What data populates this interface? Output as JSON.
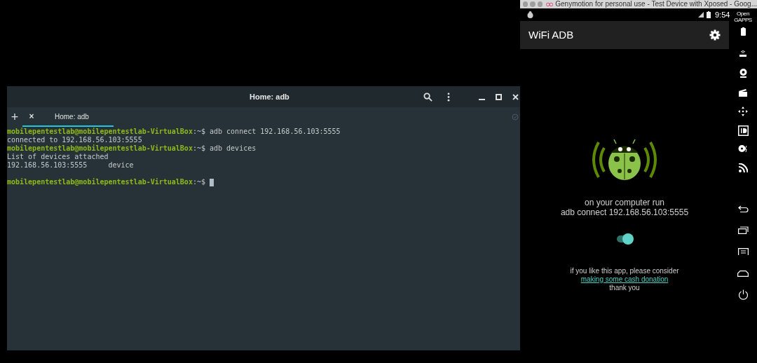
{
  "terminal": {
    "title": "Home: adb",
    "new_tab": "+",
    "tabs": [
      {
        "close": "×",
        "label": "Home: adb",
        "selected": true
      }
    ],
    "lines": [
      {
        "kind": "prompt",
        "user": "mobilepentestlab@mobilepentestlab-VirtualBox",
        "path": ":~$",
        "command": "adb connect 192.168.56.103:5555"
      },
      {
        "kind": "output",
        "text": "connected to 192.168.56.103:5555"
      },
      {
        "kind": "prompt",
        "user": "mobilepentestlab@mobilepentestlab-VirtualBox",
        "path": ":~$",
        "command": "adb devices"
      },
      {
        "kind": "output",
        "text": "List of devices attached"
      },
      {
        "kind": "output",
        "text": "192.168.56.103:5555     device"
      },
      {
        "kind": "blank"
      },
      {
        "kind": "prompt",
        "user": "mobilepentestlab@mobilepentestlab-VirtualBox",
        "path": ":~$",
        "cursor": true
      }
    ]
  },
  "emulator": {
    "window_title": "Genymotion for personal use - Test Device with Xposed - Goog...",
    "status_time": "9:54",
    "app_title": "WiFi ADB",
    "instructions": [
      "on your computer run",
      "adb connect 192.168.56.103:5555"
    ],
    "toggle": {
      "on": true
    },
    "donation": {
      "text": "if you like this app, please consider",
      "link": "making some cash donation",
      "thanks": "thank you"
    },
    "sidebar_label": "Open GAPPS"
  }
}
